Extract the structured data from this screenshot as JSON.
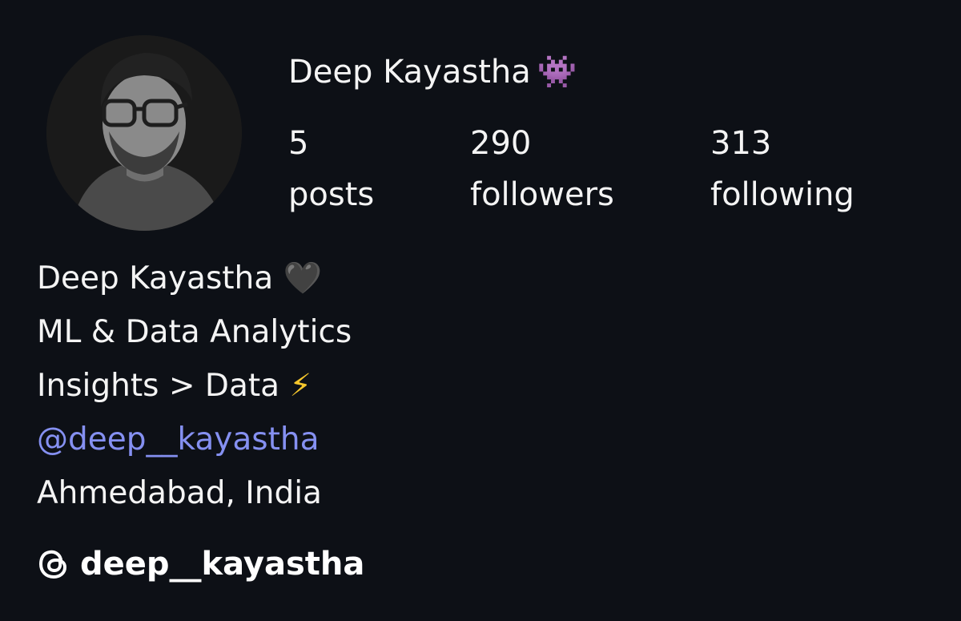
{
  "profile": {
    "username": "Deep Kayastha",
    "username_emoji": "👾",
    "stats": {
      "posts_count": "5",
      "posts_label": "posts",
      "followers_count": "290",
      "followers_label": "followers",
      "following_count": "313",
      "following_label": "following"
    },
    "bio": {
      "name": "Deep Kayastha",
      "name_emoji": "🖤",
      "line2": "ML & Data Analytics",
      "line3": "Insights > Data",
      "line3_emoji": "⚡",
      "mention": "@deep__kayastha",
      "location": "Ahmedabad, India"
    },
    "threads": {
      "icon": "threads-icon",
      "handle": "deep__kayastha"
    }
  },
  "colors": {
    "background": "#0d1016",
    "text": "#f4f4f4",
    "link": "#8590f1"
  }
}
